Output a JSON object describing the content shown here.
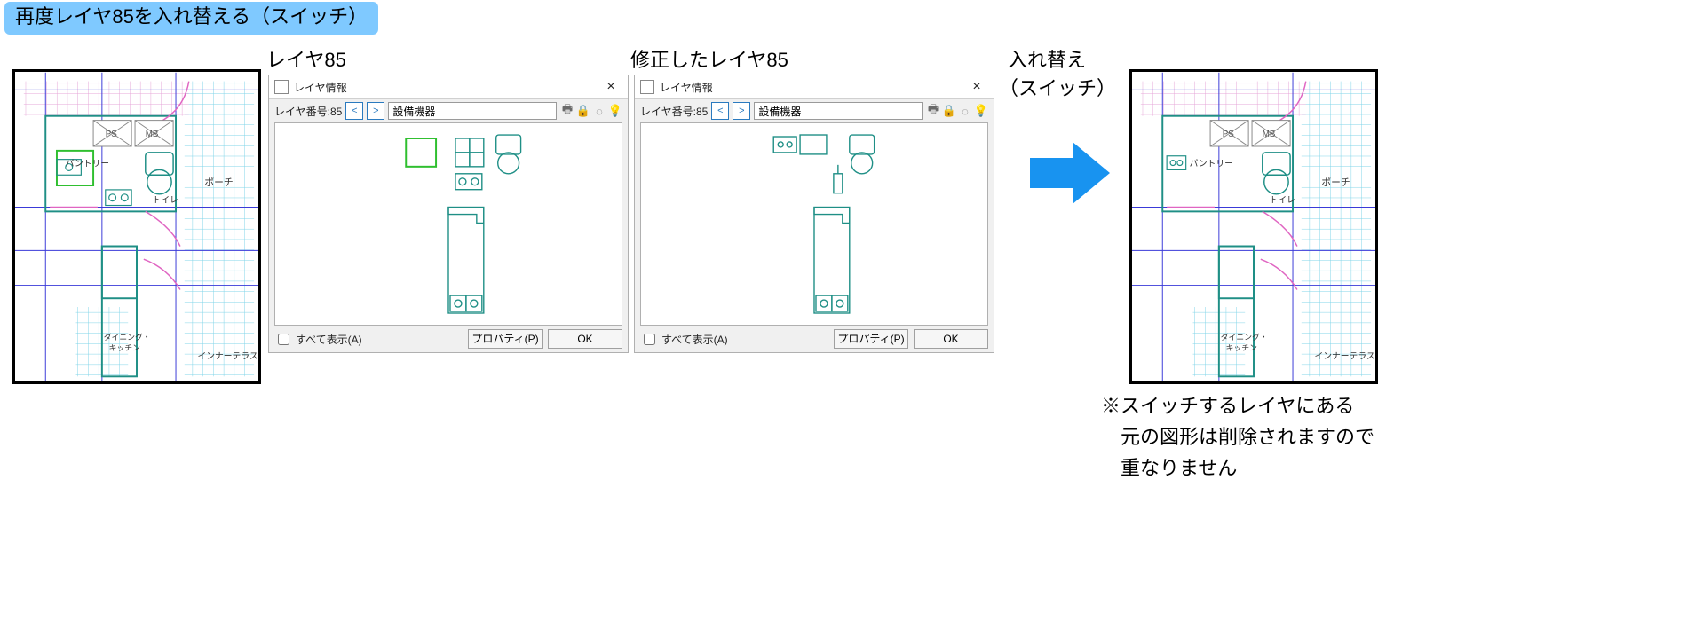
{
  "heading": "再度レイヤ85を入れ替える（スイッチ）",
  "captions": {
    "layer85": "レイヤ85",
    "layer85_fixed": "修正したレイヤ85",
    "swap_line1": "入れ替え",
    "swap_line2": "（スイッチ）"
  },
  "dialog": {
    "title": "レイヤ情報",
    "close_glyph": "×",
    "layer_number_label": "レイヤ番号:85",
    "nav_prev_glyph": "<",
    "nav_next_glyph": ">",
    "layer_name": "設備機器",
    "toolbar_icons": {
      "print": "🖶",
      "lock": "🔒",
      "dim": "◌",
      "bulb": "💡"
    },
    "show_all_label": "すべて表示(A)",
    "properties_button": "プロパティ(P)",
    "ok_button": "OK"
  },
  "plan_labels": {
    "pantry": "パントリー",
    "toilet": "トイレ",
    "porch": "ポーチ",
    "inner_terrace": "インナーテラス",
    "dining_kitchen_line1": "ダイニング・",
    "dining_kitchen_line2": "キッチン",
    "ps": "PS",
    "mb": "MB"
  },
  "footnote": {
    "l1": "※スイッチするレイヤにある",
    "l2": "　元の図形は削除されますので",
    "l3": "　重なりません"
  },
  "colors": {
    "teal": "#1f8f86",
    "cyan_grid": "#7fd4e8",
    "magenta": "#e065c2",
    "blue_grid": "#3a3ad8",
    "green": "#2fbf2f",
    "arrow": "#1893f0"
  }
}
